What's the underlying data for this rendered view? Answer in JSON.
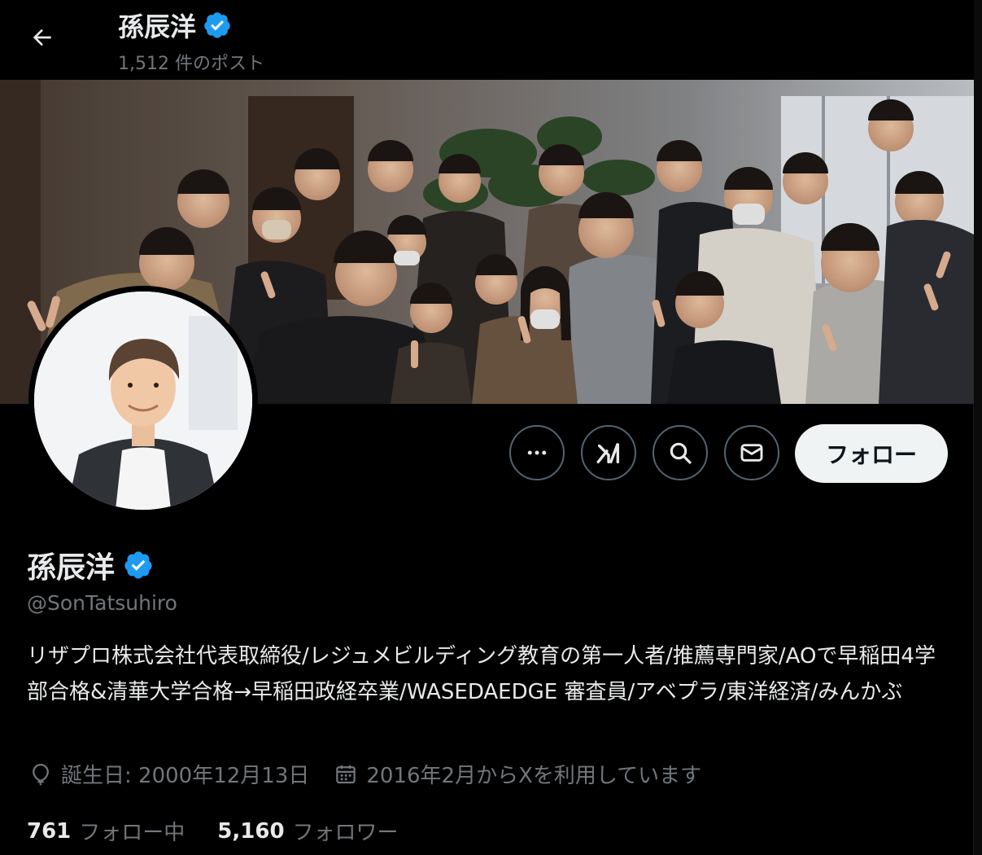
{
  "header": {
    "title": "孫辰洋",
    "post_count": "1,512 件のポスト"
  },
  "profile": {
    "name": "孫辰洋",
    "handle": "@SonTatsuhiro",
    "bio": "リザプロ株式会社代表取締役/レジュメビルディング教育の第一人者/推薦専門家/AOで早稲田4学部合格&清華大学合格→早稲田政経卒業/WASEDAEDGE 審査員/アベプラ/東洋経済/みんかぶ",
    "birthday": "誕生日: 2000年12月13日",
    "joined": "2016年2月からXを利用しています",
    "following_count": "761",
    "following_label": "フォロー中",
    "followers_count": "5,160",
    "followers_label": "フォロワー"
  },
  "actions": {
    "follow_label": "フォロー",
    "icons": [
      "more-icon",
      "grok-icon",
      "search-icon",
      "message-icon"
    ]
  },
  "colors": {
    "background": "#000000",
    "text": "#e7e9ea",
    "secondary": "#71767b",
    "verified": "#1d9bf0",
    "button_border": "#536471",
    "follow_bg": "#eff3f4"
  }
}
